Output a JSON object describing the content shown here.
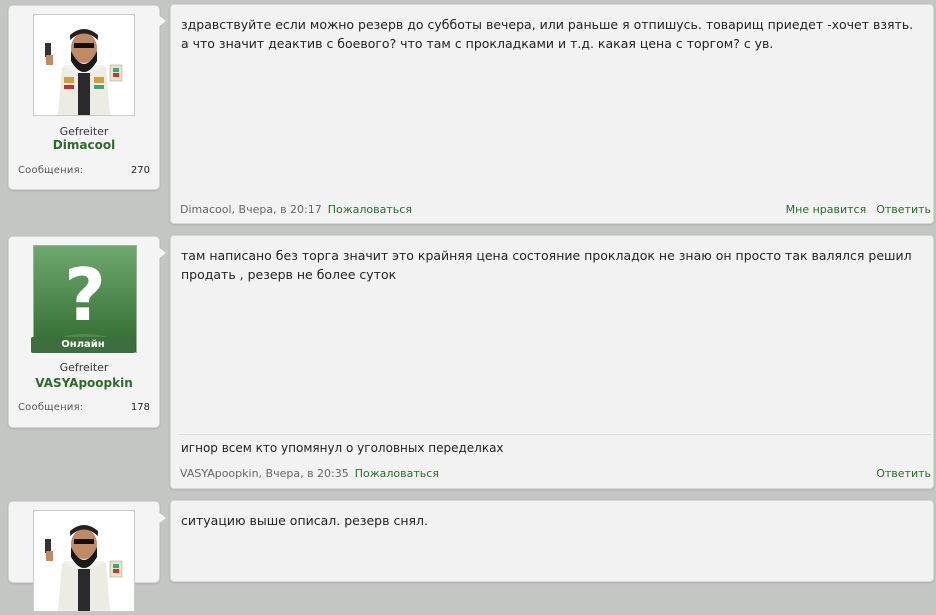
{
  "posts": [
    {
      "user": {
        "rank": "Gefreiter",
        "name": "Dimacool",
        "stat_label": "Сообщения:",
        "stat_value": "270",
        "avatar": "dictator-avatar"
      },
      "text": "здравствуйте если можно резерв до субботы вечера, или раньше я отпишусь. товарищ приедет -хочет взять.\nа что значит деактив с боевого? что там с прокладками и т.д. какая цена с торгом? с ув.",
      "meta": "Dimacool, Вчера, в 20:17",
      "report": "Пожаловаться",
      "like": "Мне нравится",
      "reply": "Ответить"
    },
    {
      "user": {
        "rank": "Gefreiter",
        "name": "VASYApoopkin",
        "stat_label": "Сообщения:",
        "stat_value": "178",
        "avatar": "question-mark-avatar",
        "status": "Онлайн"
      },
      "text": "там написано без торга значит это крайняя цена состояние прокладок не знаю он просто так валялся решил продать , резерв не более суток",
      "signature": "игнор всем кто упомянул о уголовных переделках",
      "meta": "VASYApoopkin, Вчера, в 20:35",
      "report": "Пожаловаться",
      "reply": "Ответить"
    },
    {
      "user": {
        "avatar": "dictator-avatar"
      },
      "text": "ситуацию выше описал. резерв снял."
    }
  ]
}
